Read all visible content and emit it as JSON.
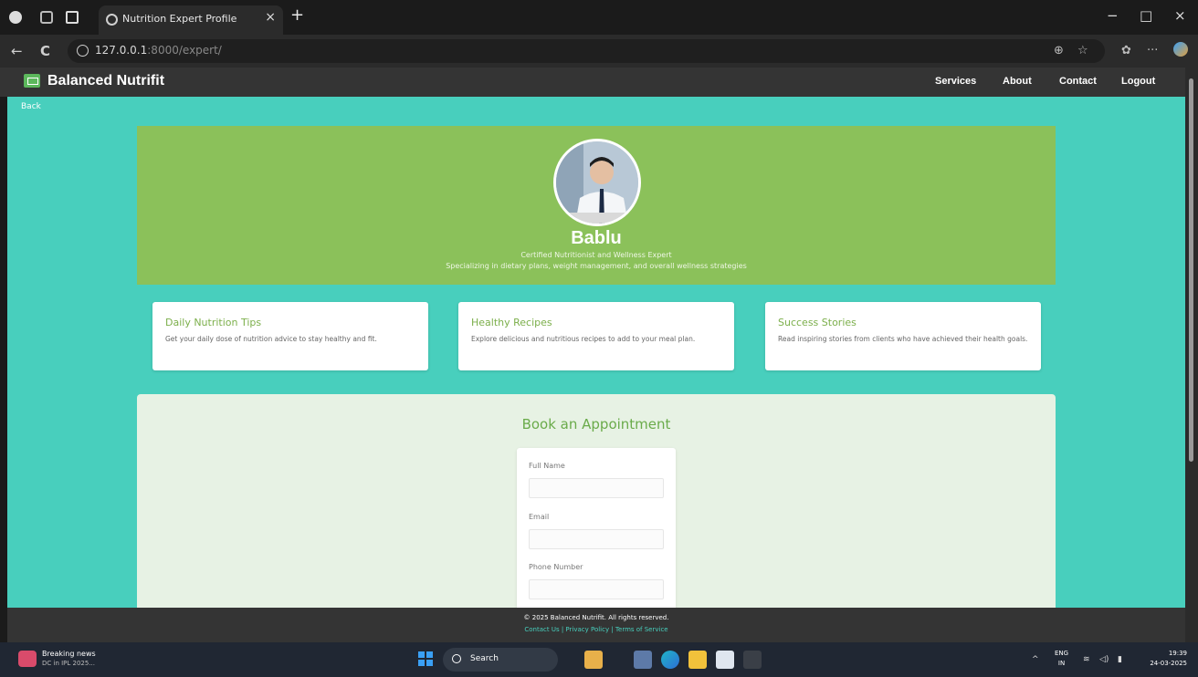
{
  "browser": {
    "tab_title": "Nutrition Expert Profile",
    "tab_close": "×",
    "new_tab": "+",
    "url_host": "127.0.0.1",
    "url_rest": ":8000/expert/",
    "back": "←",
    "refresh": "C",
    "minimize": "−",
    "maximize": "□",
    "close": "×",
    "more": "···",
    "icons": [
      "profile-icon",
      "workspaces-icon",
      "tab-actions-icon",
      "info-icon",
      "zoom-icon",
      "favorite-icon",
      "collections-icon",
      "copilot-icon"
    ]
  },
  "navbar": {
    "brand": "Balanced Nutrifit",
    "items": [
      "Services",
      "About",
      "Contact",
      "Logout"
    ]
  },
  "page": {
    "back_link": "Back"
  },
  "hero": {
    "name": "Bablu",
    "title": "Certified Nutritionist and Wellness Expert",
    "specialty": "Specializing in dietary plans, weight management, and overall wellness strategies"
  },
  "cards": [
    {
      "title": "Daily Nutrition Tips",
      "text": "Get your daily dose of nutrition advice to stay healthy and fit."
    },
    {
      "title": "Healthy Recipes",
      "text": "Explore delicious and nutritious recipes to add to your meal plan."
    },
    {
      "title": "Success Stories",
      "text": "Read inspiring stories from clients who have achieved their health goals."
    }
  ],
  "booking": {
    "heading": "Book an Appointment",
    "fields": [
      {
        "label": "Full Name",
        "value": ""
      },
      {
        "label": "Email",
        "value": ""
      },
      {
        "label": "Phone Number",
        "value": ""
      }
    ]
  },
  "footer": {
    "copyright": "© 2025 Balanced Nutrifit. All rights reserved.",
    "links": "Contact Us  |  Privacy Policy  |  Terms of Service"
  },
  "taskbar": {
    "news_title": "Breaking news",
    "news_sub": "DC in IPL 2025...",
    "search": "Search",
    "lang1": "ENG",
    "lang2": "IN",
    "time": "19:39",
    "date": "24-03-2025"
  },
  "colors": {
    "page_bg": "#48cfbd",
    "hero_bg": "#8bc15a",
    "navbar_bg": "#343434",
    "booking_bg": "#e7f2e4",
    "accent_green": "#7caf4b"
  }
}
